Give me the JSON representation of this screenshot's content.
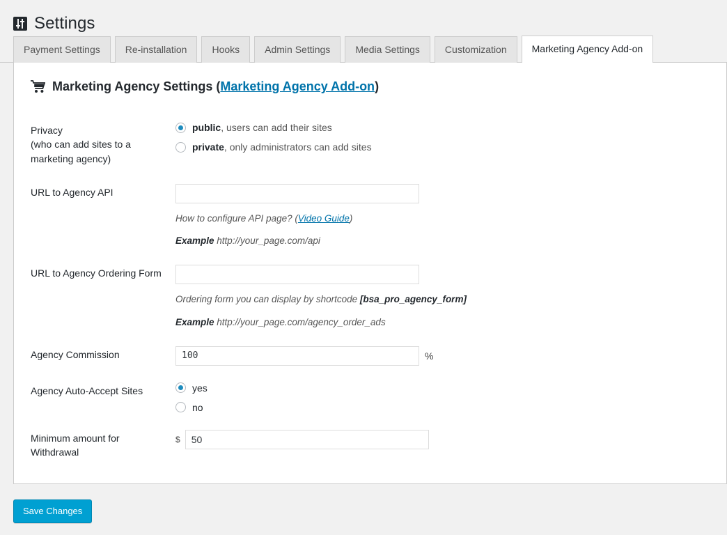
{
  "header": {
    "icon": "settings-sliders-icon",
    "title": "Settings"
  },
  "tabs": [
    {
      "label": "Payment Settings",
      "active": false
    },
    {
      "label": "Re-installation",
      "active": false
    },
    {
      "label": "Hooks",
      "active": false
    },
    {
      "label": "Admin Settings",
      "active": false
    },
    {
      "label": "Media Settings",
      "active": false
    },
    {
      "label": "Customization",
      "active": false
    },
    {
      "label": "Marketing Agency Add-on",
      "active": true
    }
  ],
  "section": {
    "icon": "shopping-cart-icon",
    "title_prefix": "Marketing Agency Settings (",
    "title_link": "Marketing Agency Add-on",
    "title_suffix": ")"
  },
  "form": {
    "privacy": {
      "label_line1": "Privacy",
      "label_line2": "(who can add sites to a",
      "label_line3": "marketing agency)",
      "option_public_bold": "public",
      "option_public_rest": ", users can add their sites",
      "option_private_bold": "private",
      "option_private_rest": ", only administrators can add sites",
      "selected": "public"
    },
    "agency_api": {
      "label": "URL to Agency API",
      "value": "",
      "placeholder": "",
      "hint1_before": "How to configure API page? (",
      "hint1_link": "Video Guide",
      "hint1_after": ")",
      "hint2_bold": "Example",
      "hint2_rest": " http://your_page.com/api"
    },
    "ordering_form": {
      "label": "URL to Agency Ordering Form",
      "value": "",
      "placeholder": "",
      "hint1_rest": "Ordering form you can display by shortcode ",
      "hint1_bold": "[bsa_pro_agency_form]",
      "hint2_bold": "Example",
      "hint2_rest": " http://your_page.com/agency_order_ads"
    },
    "commission": {
      "label": "Agency Commission",
      "value": "100",
      "suffix": "%"
    },
    "auto_accept": {
      "label": "Agency Auto-Accept Sites",
      "option_yes": "yes",
      "option_no": "no",
      "selected": "yes"
    },
    "minimum_withdrawal": {
      "label_line1": "Minimum amount for",
      "label_line2": "Withdrawal",
      "prefix": "$",
      "value": "50"
    }
  },
  "footer": {
    "save_label": "Save Changes"
  },
  "colors": {
    "page_background": "#f1f1f1",
    "accent_blue": "#00a0d2",
    "link_blue": "#0073aa",
    "radio_blue": "#1e8cbe",
    "text_dark": "#23282d"
  }
}
